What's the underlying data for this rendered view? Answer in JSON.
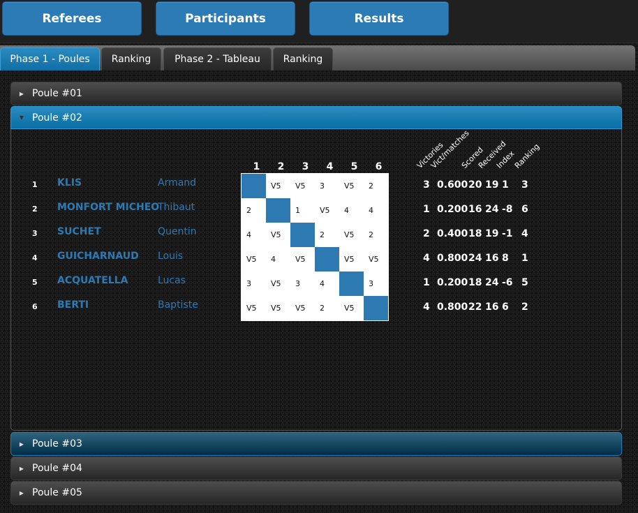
{
  "nav": {
    "buttons": [
      {
        "label": "Referees"
      },
      {
        "label": "Participants"
      },
      {
        "label": "Results"
      }
    ]
  },
  "tabs": [
    {
      "label": "Phase 1 - Poules",
      "active": true
    },
    {
      "label": "Ranking",
      "active": false
    },
    {
      "label": "Phase 2 - Tableau",
      "active": false
    },
    {
      "label": "Ranking",
      "active": false
    }
  ],
  "accordion": [
    {
      "title": "Poule #01",
      "state": "collapsed",
      "icon": "triangle-right-icon"
    },
    {
      "title": "Poule #02",
      "state": "expanded",
      "icon": "triangle-down-icon"
    },
    {
      "title": "Poule #03",
      "state": "hover",
      "icon": "triangle-right-icon"
    },
    {
      "title": "Poule #04",
      "state": "collapsed",
      "icon": "triangle-right-icon"
    },
    {
      "title": "Poule #05",
      "state": "collapsed",
      "icon": "triangle-right-icon"
    }
  ],
  "poule": {
    "column_numbers": [
      "1",
      "2",
      "3",
      "4",
      "5",
      "6"
    ],
    "stat_headers": [
      "Victories",
      "Vict/matches",
      "Scored",
      "Received",
      "Index",
      "Ranking"
    ],
    "fencers": [
      {
        "num": "1",
        "last": "KLIS",
        "first": "Armand",
        "results": [
          "",
          "V5",
          "V5",
          "3",
          "V5",
          "2"
        ],
        "victories": "3",
        "ratio": "0.600",
        "scored": "20",
        "received": "19",
        "index": "1",
        "ranking": "3"
      },
      {
        "num": "2",
        "last": "MONFORT MICHEO",
        "first": "Thibaut",
        "results": [
          "2",
          "",
          "1",
          "V5",
          "4",
          "4"
        ],
        "victories": "1",
        "ratio": "0.200",
        "scored": "16",
        "received": "24",
        "index": "-8",
        "ranking": "6"
      },
      {
        "num": "3",
        "last": "SUCHET",
        "first": "Quentin",
        "results": [
          "4",
          "V5",
          "",
          "2",
          "V5",
          "2"
        ],
        "victories": "2",
        "ratio": "0.400",
        "scored": "18",
        "received": "19",
        "index": "-1",
        "ranking": "4"
      },
      {
        "num": "4",
        "last": "GUICHARNAUD",
        "first": "Louis",
        "results": [
          "V5",
          "4",
          "V5",
          "",
          "V5",
          "V5"
        ],
        "victories": "4",
        "ratio": "0.800",
        "scored": "24",
        "received": "16",
        "index": "8",
        "ranking": "1"
      },
      {
        "num": "5",
        "last": "ACQUATELLA",
        "first": "Lucas",
        "results": [
          "3",
          "V5",
          "3",
          "4",
          "",
          "3"
        ],
        "victories": "1",
        "ratio": "0.200",
        "scored": "18",
        "received": "24",
        "index": "-6",
        "ranking": "5"
      },
      {
        "num": "6",
        "last": "BERTI",
        "first": "Baptiste",
        "results": [
          "V5",
          "V5",
          "V5",
          "2",
          "V5",
          ""
        ],
        "victories": "4",
        "ratio": "0.800",
        "scored": "22",
        "received": "16",
        "index": "6",
        "ranking": "2"
      }
    ]
  },
  "colors": {
    "accent": "#2d7ab3",
    "active_header": "#0f6ea3",
    "hover_header": "#012d46"
  }
}
